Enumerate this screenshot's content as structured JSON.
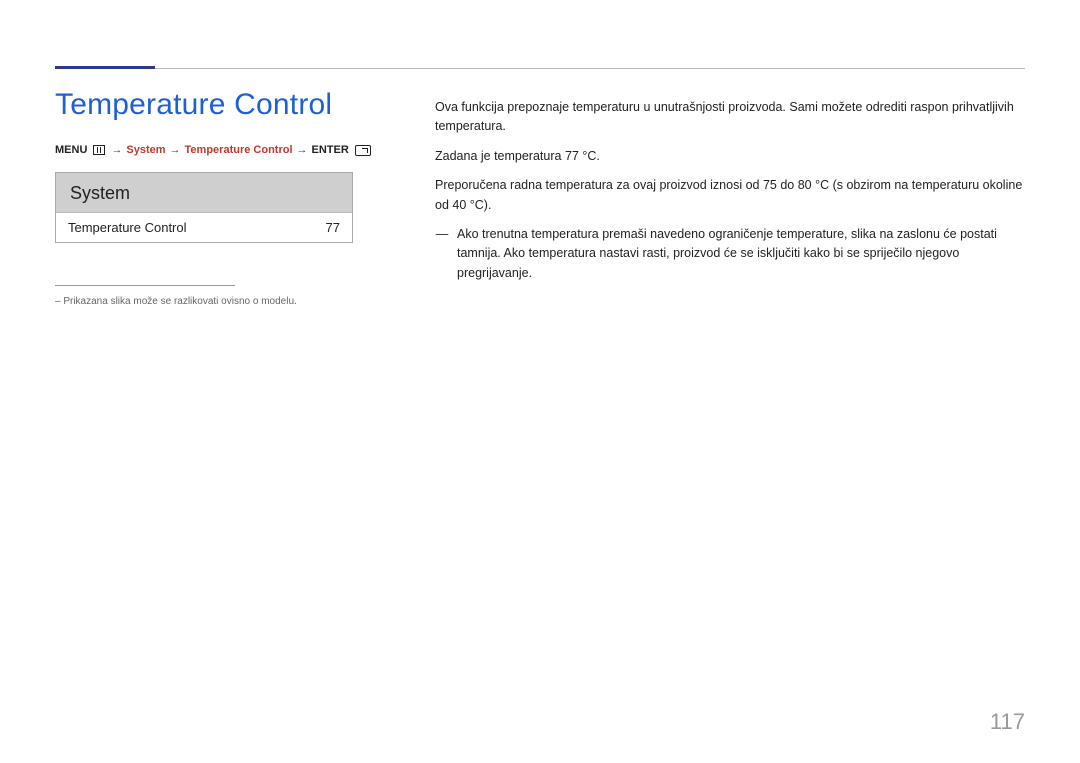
{
  "title": "Temperature Control",
  "breadcrumb": {
    "menu": "MENU",
    "arrow": "→",
    "system": "System",
    "temp": "Temperature Control",
    "enter": "ENTER"
  },
  "menu_card": {
    "header": "System",
    "row_label": "Temperature Control",
    "row_value": "77"
  },
  "left_footnote": "–  Prikazana slika može se razlikovati ovisno o modelu.",
  "body": {
    "p1": "Ova funkcija prepoznaje temperaturu u unutrašnjosti proizvoda. Sami možete odrediti raspon prihvatljivih temperatura.",
    "p2": "Zadana je temperatura 77 °C.",
    "p3": "Preporučena radna temperatura za ovaj proizvod iznosi od 75 do 80 °C (s obzirom na temperaturu okoline od 40 °C).",
    "note_dash": "―",
    "note": "Ako trenutna temperatura premaši navedeno ograničenje temperature, slika na zaslonu će postati tamnija. Ako temperatura nastavi rasti, proizvod će se isključiti kako bi se spriječilo njegovo pregrijavanje."
  },
  "page_number": "117"
}
